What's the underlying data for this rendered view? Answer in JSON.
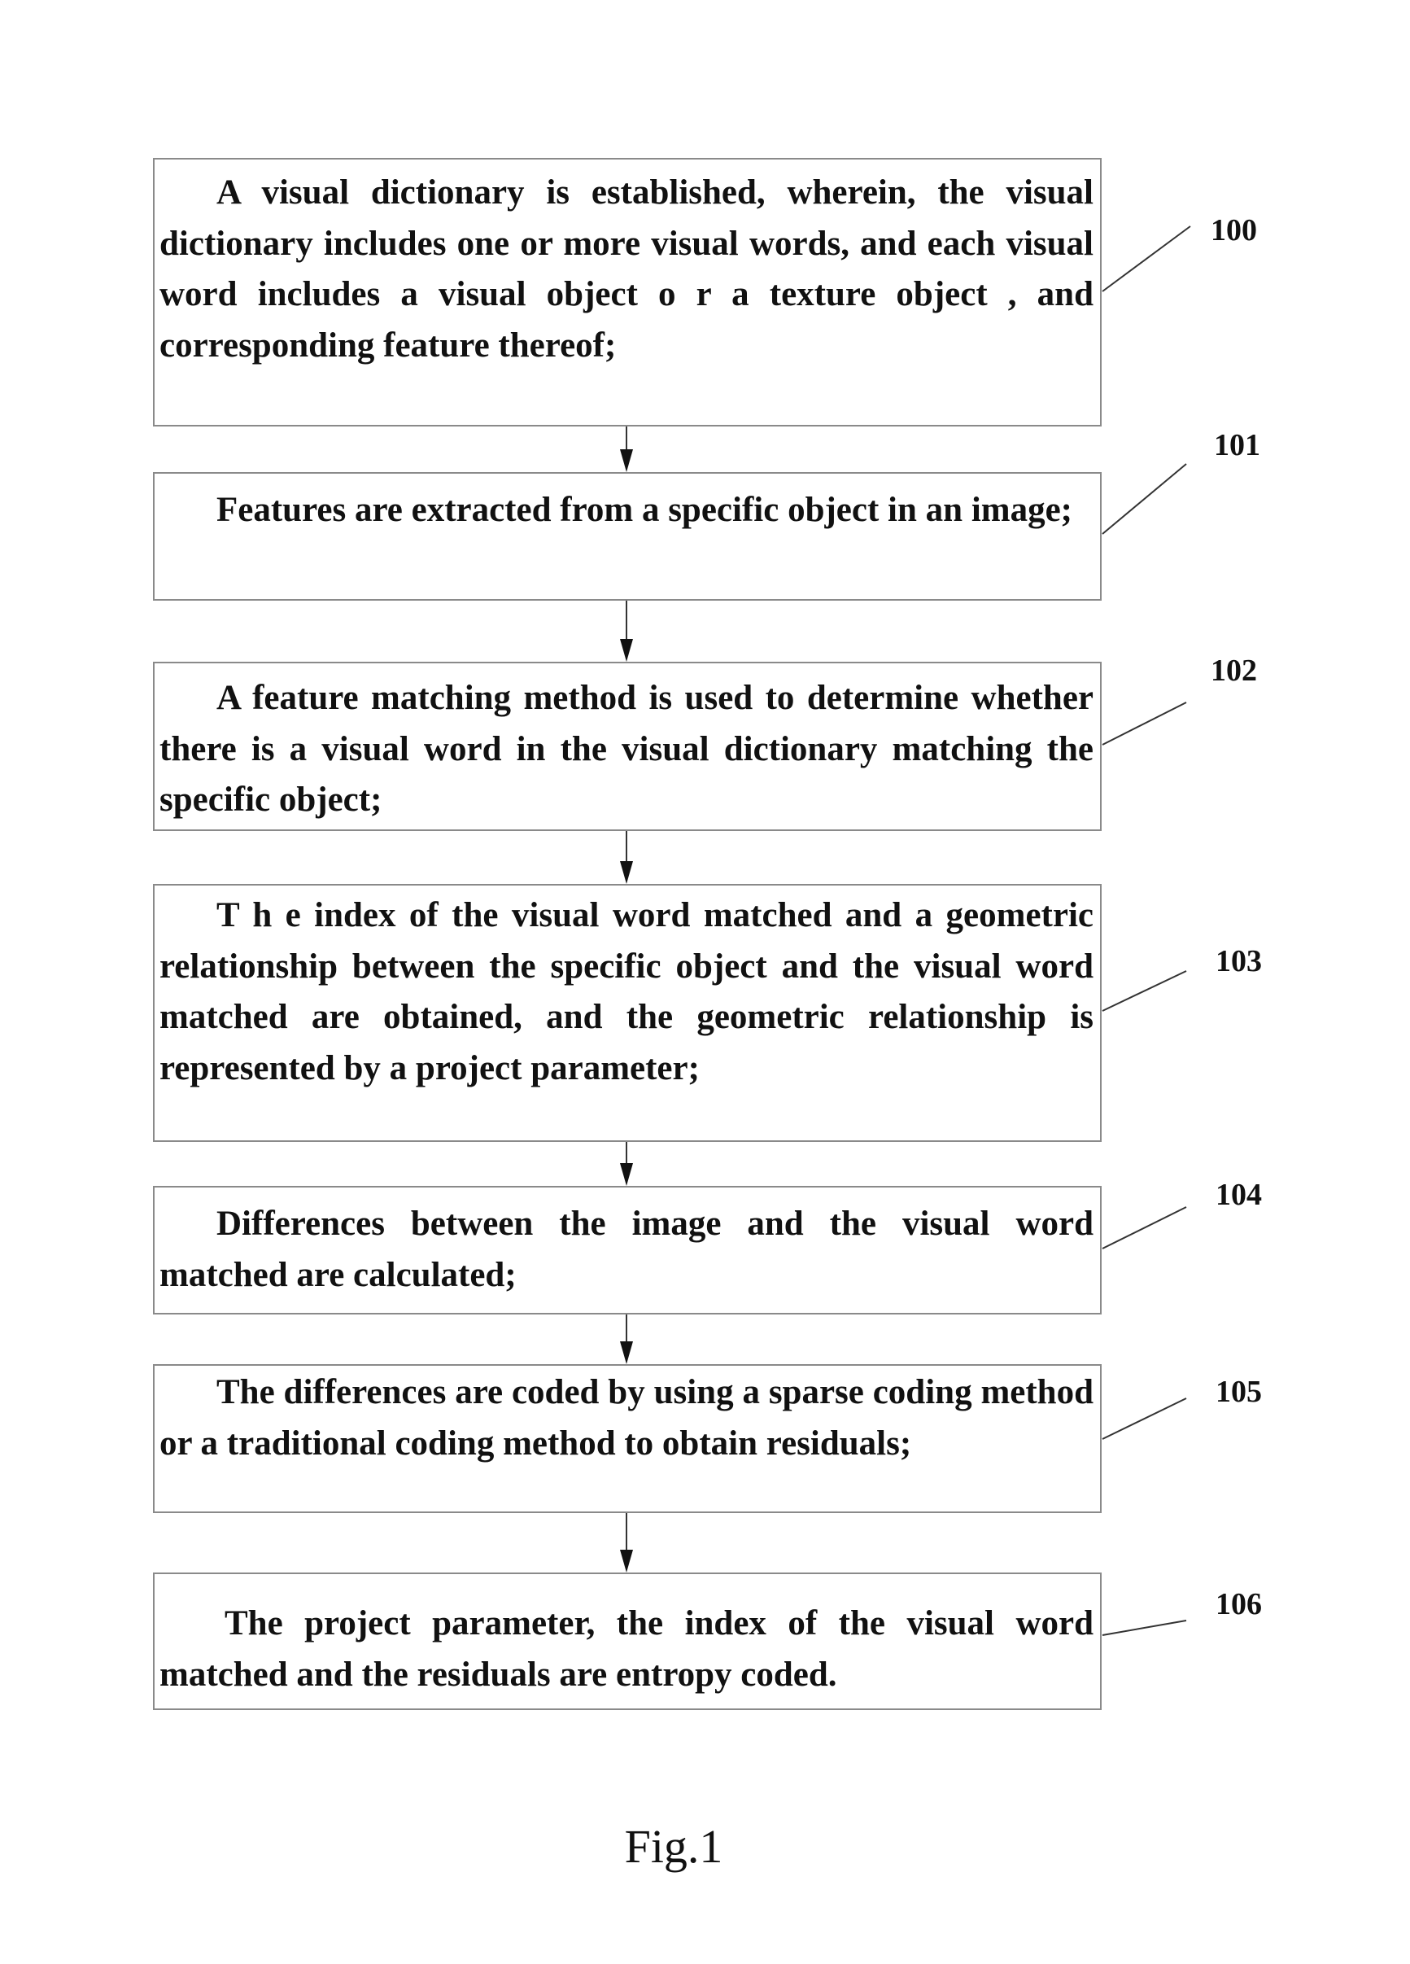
{
  "figure": {
    "caption": "Fig.1",
    "steps": [
      {
        "ref": "100",
        "text": "A visual dictionary is established, wherein, the visual dictionary includes one or more visual words, and each visual word includes a visual object o r a texture object , and corresponding feature thereof;"
      },
      {
        "ref": "101",
        "text": "Features are extracted from a specific object in an image;"
      },
      {
        "ref": "102",
        "text": "A feature matching method is used to determine whether there is a visual word in the visual dictionary matching the specific object;"
      },
      {
        "ref": "103",
        "text": "T h e index of the visual word matched and a geometric relationship between the specific object and the visual word matched are obtained, and the geometric relationship is represented by a project parameter;"
      },
      {
        "ref": "104",
        "text": "Differences between the image and the visual word matched are calculated;"
      },
      {
        "ref": "105",
        "text": "The differences are coded by using a sparse coding method or a traditional coding method to obtain residuals;"
      },
      {
        "ref": "106",
        "text": "The project parameter, the index of the visual word matched and the residuals are entropy coded."
      }
    ],
    "connectors": [
      {
        "from": "100",
        "to": "101"
      },
      {
        "from": "101",
        "to": "102"
      },
      {
        "from": "102",
        "to": "103"
      },
      {
        "from": "103",
        "to": "104"
      },
      {
        "from": "104",
        "to": "105"
      },
      {
        "from": "105",
        "to": "106"
      }
    ]
  }
}
